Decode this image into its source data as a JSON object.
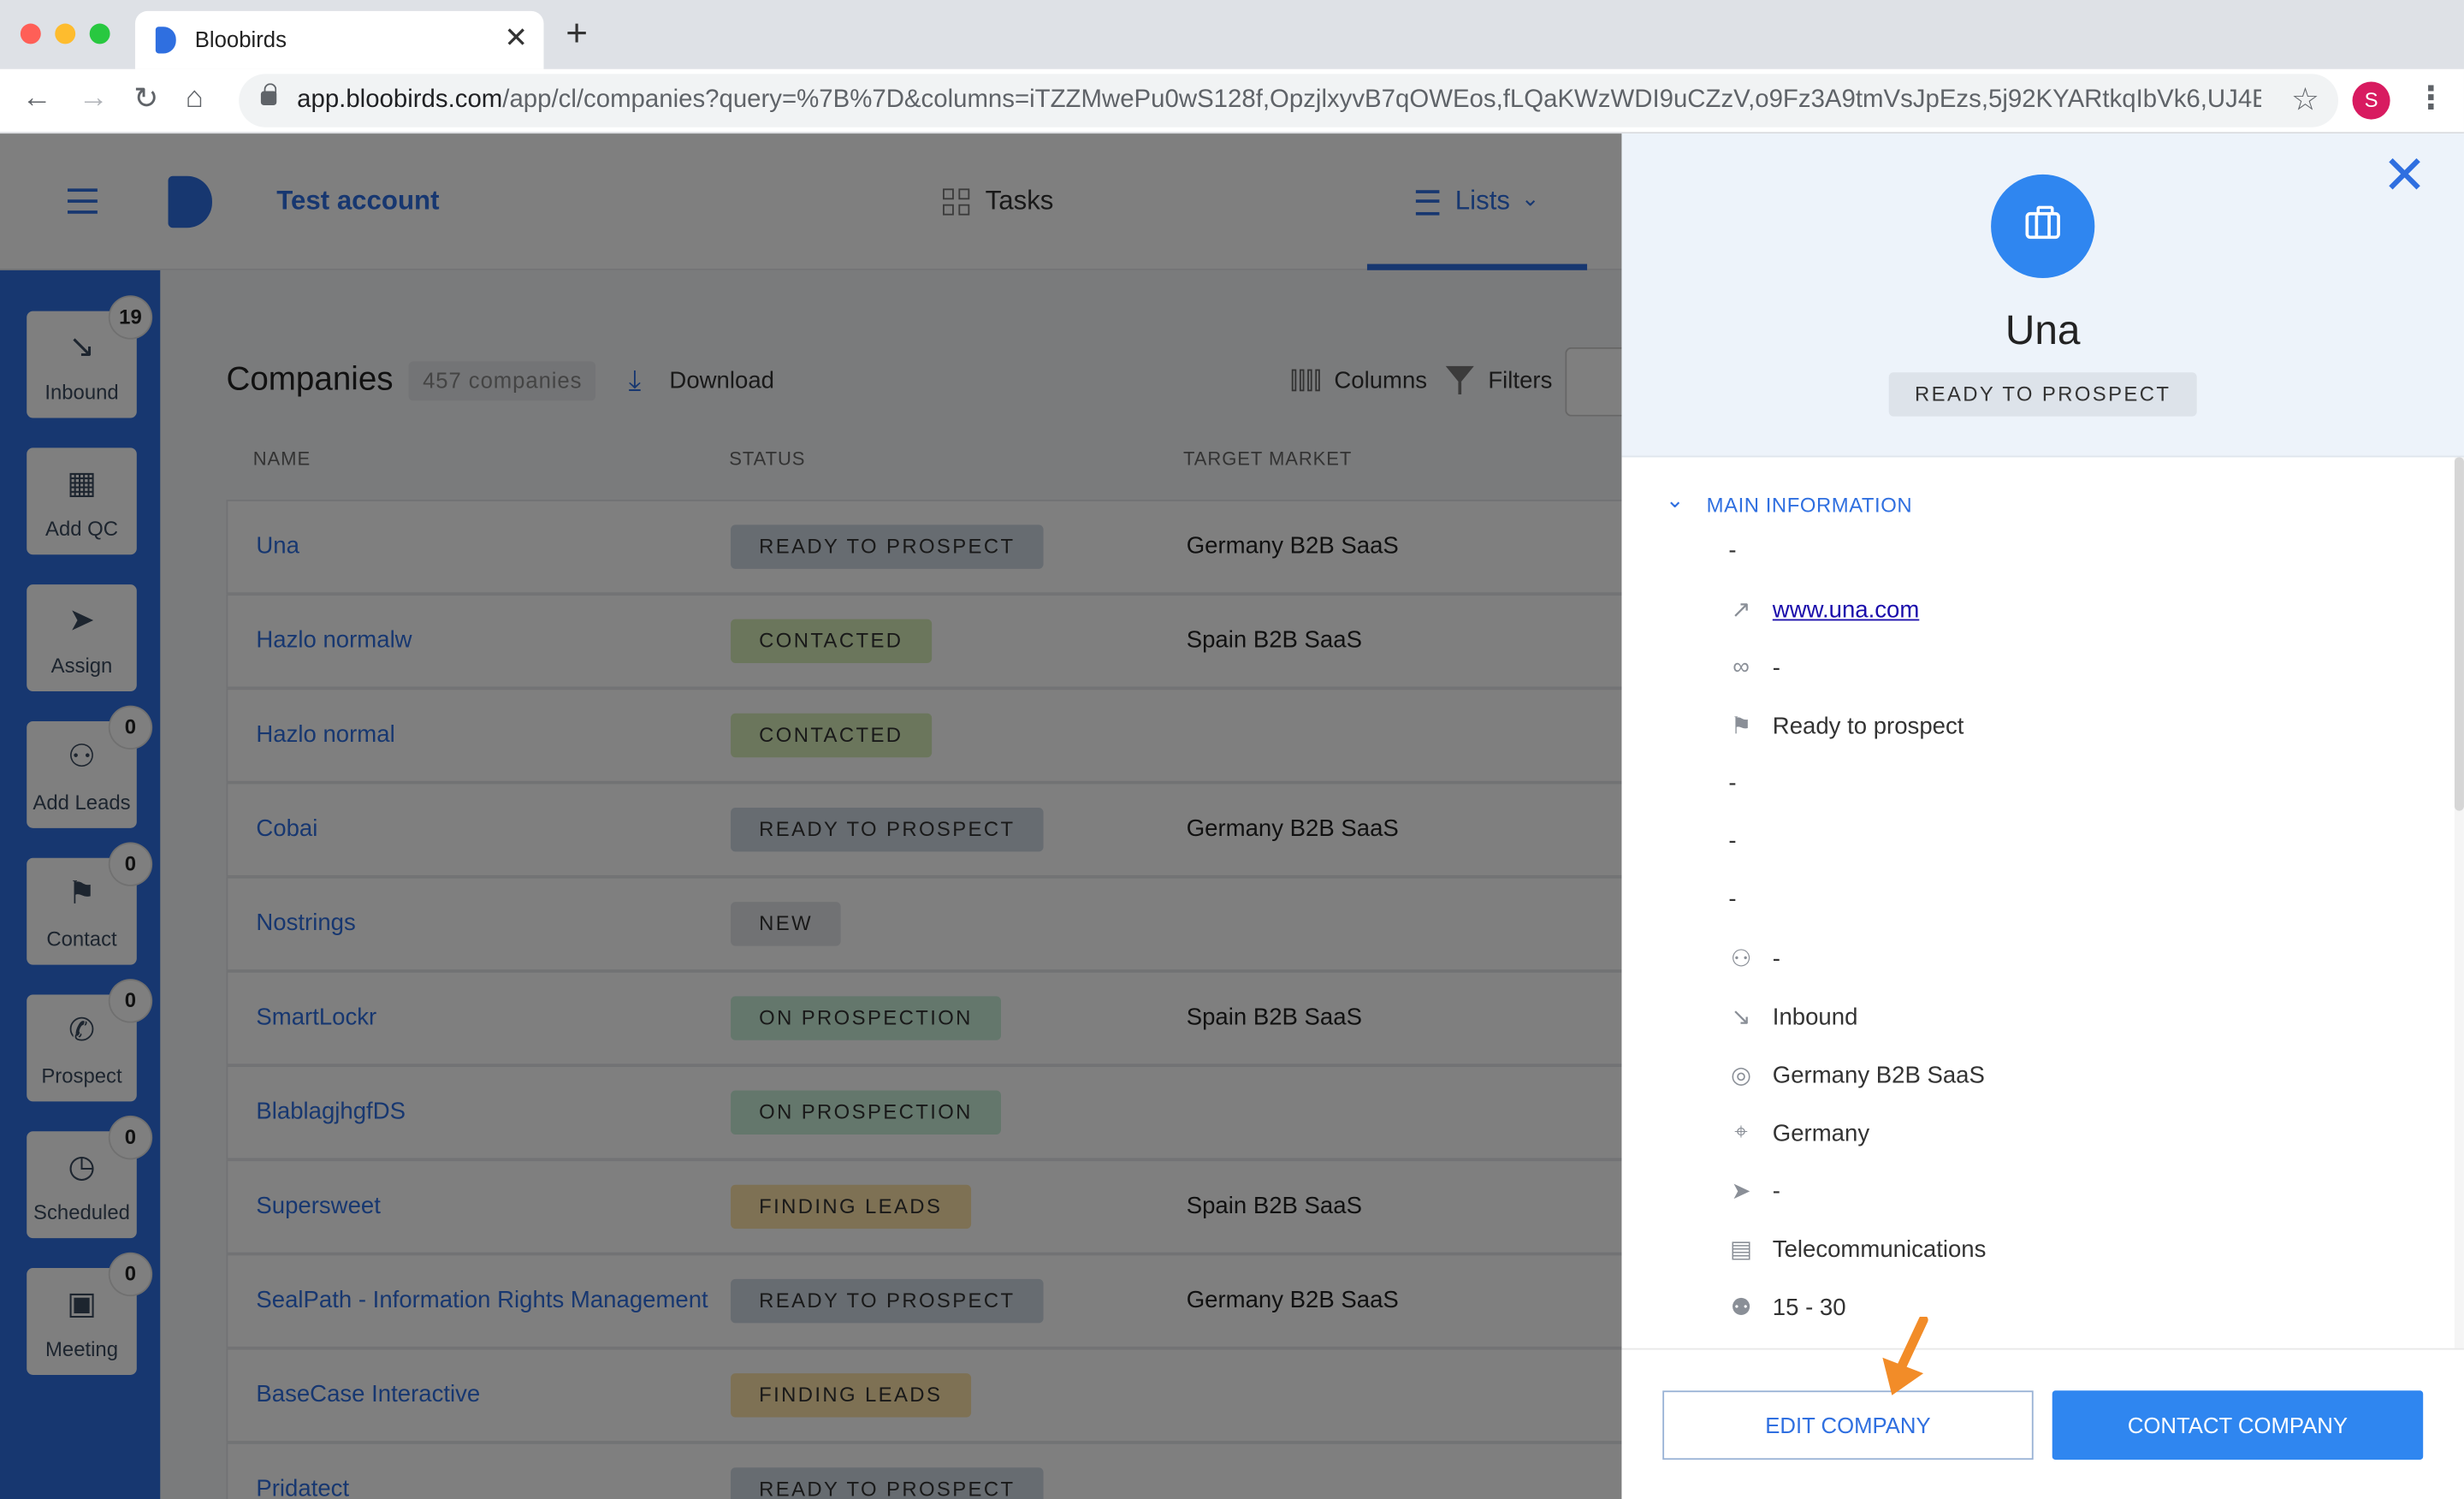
{
  "browser": {
    "tab_title": "Bloobirds",
    "url_host": "app.bloobirds.com",
    "url_path": "/app/cl/companies?query=%7B%7D&columns=iTZZMwePu0wS128f,OpzjlxyvB7qOWEos,fLQaKWzWDI9uCZzV,o9Fz3A9tmVsJpEzs,5j92KYARtkqIbVk6,UJ4B32HO...",
    "profile_initial": "S"
  },
  "header": {
    "account": "Test account",
    "tasks_label": "Tasks",
    "lists_label": "Lists"
  },
  "sidebar": {
    "items": [
      {
        "label": "Inbound",
        "badge": "19",
        "icon": "arrow-down-right-icon"
      },
      {
        "label": "Add QC",
        "badge": "",
        "icon": "building-icon"
      },
      {
        "label": "Assign",
        "badge": "",
        "icon": "send-icon"
      },
      {
        "label": "Add Leads",
        "badge": "0",
        "icon": "user-plus-icon"
      },
      {
        "label": "Contact",
        "badge": "0",
        "icon": "flag-icon"
      },
      {
        "label": "Prospect",
        "badge": "0",
        "icon": "phone-icon"
      },
      {
        "label": "Scheduled",
        "badge": "0",
        "icon": "clock-icon"
      },
      {
        "label": "Meeting",
        "badge": "0",
        "icon": "calendar-icon"
      }
    ]
  },
  "companies": {
    "title": "Companies",
    "count": "457 companies",
    "download_label": "Download",
    "columns_label": "Columns",
    "filters_label": "Filters",
    "headers": [
      "NAME",
      "STATUS",
      "TARGET MARKET"
    ],
    "rows": [
      {
        "name": "Una",
        "status": "READY TO PROSPECT",
        "market": "Germany B2B SaaS"
      },
      {
        "name": "Hazlo normalw",
        "status": "CONTACTED",
        "market": "Spain B2B SaaS"
      },
      {
        "name": "Hazlo normal",
        "status": "CONTACTED",
        "market": ""
      },
      {
        "name": "Cobai",
        "status": "READY TO PROSPECT",
        "market": "Germany B2B SaaS"
      },
      {
        "name": "Nostrings",
        "status": "NEW",
        "market": ""
      },
      {
        "name": "SmartLockr",
        "status": "ON PROSPECTION",
        "market": "Spain B2B SaaS"
      },
      {
        "name": "BlablagjhgfDS",
        "status": "ON PROSPECTION",
        "market": ""
      },
      {
        "name": "Supersweet",
        "status": "FINDING LEADS",
        "market": "Spain B2B SaaS"
      },
      {
        "name": "SealPath - Information Rights Management",
        "status": "READY TO PROSPECT",
        "market": "Germany B2B SaaS"
      },
      {
        "name": "BaseCase Interactive",
        "status": "FINDING LEADS",
        "market": ""
      },
      {
        "name": "Pridatect",
        "status": "READY TO PROSPECT",
        "market": ""
      }
    ]
  },
  "status_colors": {
    "READY TO PROSPECT": "#cfd8e3",
    "CONTACTED": "#d6edb8",
    "NEW": "#e3e5e8",
    "ON PROSPECTION": "#c8efd9",
    "FINDING LEADS": "#fce2a8"
  },
  "panel": {
    "name": "Una",
    "status": "READY TO PROSPECT",
    "section_title": "MAIN INFORMATION",
    "info": [
      {
        "icon": "",
        "value": "-"
      },
      {
        "icon": "external-link-icon",
        "value": "www.una.com",
        "link": true
      },
      {
        "icon": "link-icon",
        "value": "-"
      },
      {
        "icon": "flag-icon",
        "value": "Ready to prospect"
      },
      {
        "icon": "",
        "value": "-"
      },
      {
        "icon": "",
        "value": "-"
      },
      {
        "icon": "",
        "value": "-"
      },
      {
        "icon": "user-plus-icon",
        "value": "-"
      },
      {
        "icon": "arrow-down-right-icon",
        "value": "Inbound"
      },
      {
        "icon": "target-icon",
        "value": "Germany B2B SaaS"
      },
      {
        "icon": "map-pin-icon",
        "value": "Germany"
      },
      {
        "icon": "send-icon",
        "value": "-"
      },
      {
        "icon": "briefcase-icon",
        "value": "Telecommunications"
      },
      {
        "icon": "users-icon",
        "value": "15 - 30"
      }
    ],
    "edit_label": "EDIT COMPANY",
    "contact_label": "CONTACT COMPANY"
  }
}
